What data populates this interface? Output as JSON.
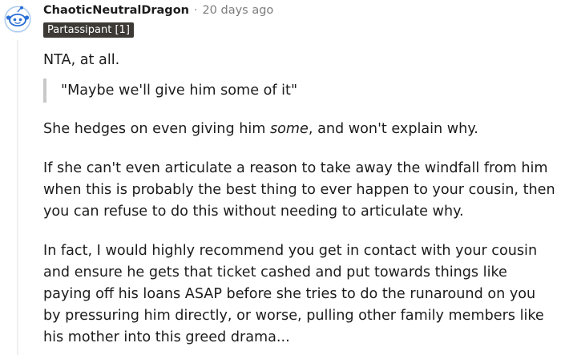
{
  "comment": {
    "author": "ChaoticNeutralDragon",
    "separator": "·",
    "timestamp": "20 days ago",
    "flair": "Partassipant [1]",
    "avatar_icon": "snoo-avatar-icon",
    "paragraph1": "NTA, at all.",
    "quote": "\"Maybe we'll give him some of it\"",
    "paragraph2": {
      "before": "She hedges on even giving him ",
      "emphasis": "some",
      "after": ", and won't explain why."
    },
    "paragraph3": "If she can't even articulate a reason to take away the windfall from him when this is probably the best thing to ever happen to your cousin, then you can refuse to do this without needing to articulate why.",
    "paragraph4": "In fact, I would highly recommend you get in contact with your cousin and ensure he gets that ticket cashed and put towards things like paying off his loans ASAP before she tries to do the runaround on you by pressuring him directly, or worse, pulling other family members like his mother into this greed drama..."
  },
  "colors": {
    "flair_bg": "#3d3a36",
    "thread_line": "#edeff1",
    "quote_bar": "#c8c8c8",
    "avatar_blue": "#2a6fd6"
  }
}
